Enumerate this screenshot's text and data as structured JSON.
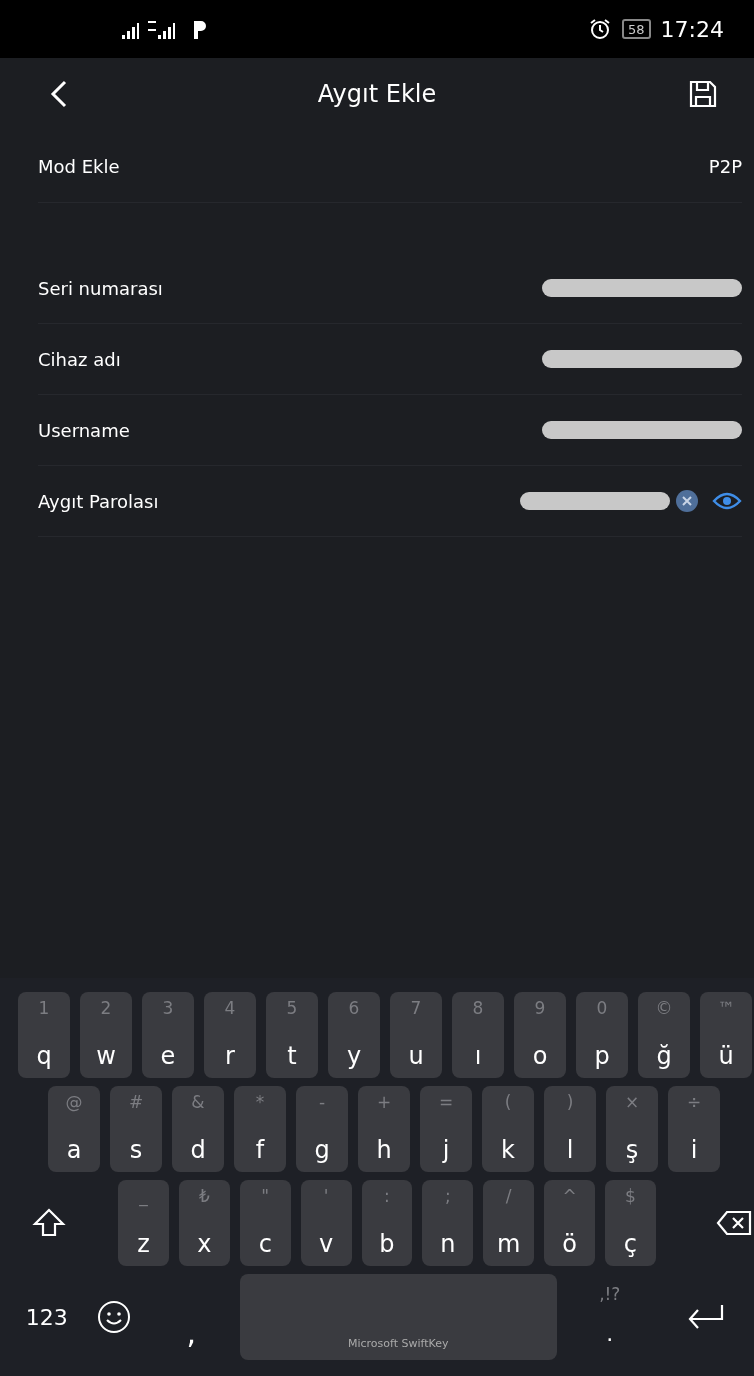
{
  "status_bar": {
    "battery": "58",
    "time": "17:24"
  },
  "header": {
    "title": "Aygıt Ekle"
  },
  "mode_row": {
    "label": "Mod Ekle",
    "value": "P2P"
  },
  "fields": [
    {
      "label": "Seri numarası",
      "kind": "redacted"
    },
    {
      "label": "Cihaz adı",
      "kind": "redacted"
    },
    {
      "label": "Username",
      "kind": "redacted"
    },
    {
      "label": "Aygıt Parolası",
      "kind": "password"
    }
  ],
  "keyboard": {
    "rows": [
      [
        {
          "main": "q",
          "hint": "1"
        },
        {
          "main": "w",
          "hint": "2"
        },
        {
          "main": "e",
          "hint": "3"
        },
        {
          "main": "r",
          "hint": "4"
        },
        {
          "main": "t",
          "hint": "5"
        },
        {
          "main": "y",
          "hint": "6"
        },
        {
          "main": "u",
          "hint": "7"
        },
        {
          "main": "ı",
          "hint": "8"
        },
        {
          "main": "o",
          "hint": "9"
        },
        {
          "main": "p",
          "hint": "0"
        },
        {
          "main": "ğ",
          "hint": "©"
        },
        {
          "main": "ü",
          "hint": "™"
        }
      ],
      [
        {
          "main": "a",
          "hint": "@"
        },
        {
          "main": "s",
          "hint": "#"
        },
        {
          "main": "d",
          "hint": "&"
        },
        {
          "main": "f",
          "hint": "*"
        },
        {
          "main": "g",
          "hint": "-"
        },
        {
          "main": "h",
          "hint": "+"
        },
        {
          "main": "j",
          "hint": "="
        },
        {
          "main": "k",
          "hint": "("
        },
        {
          "main": "l",
          "hint": ")"
        },
        {
          "main": "ş",
          "hint": "×"
        },
        {
          "main": "i",
          "hint": "÷"
        }
      ],
      [
        {
          "main": "z",
          "hint": "_"
        },
        {
          "main": "x",
          "hint": "₺"
        },
        {
          "main": "c",
          "hint": "\""
        },
        {
          "main": "v",
          "hint": "'"
        },
        {
          "main": "b",
          "hint": ":"
        },
        {
          "main": "n",
          "hint": ";"
        },
        {
          "main": "m",
          "hint": "/"
        },
        {
          "main": "ö",
          "hint": "^"
        },
        {
          "main": "ç",
          "hint": "$"
        }
      ]
    ],
    "numbers_key": "123",
    "comma_key": ",",
    "space_label": "Microsoft SwiftKey",
    "period_key": {
      "main": ".",
      "hint": ",!?"
    }
  }
}
